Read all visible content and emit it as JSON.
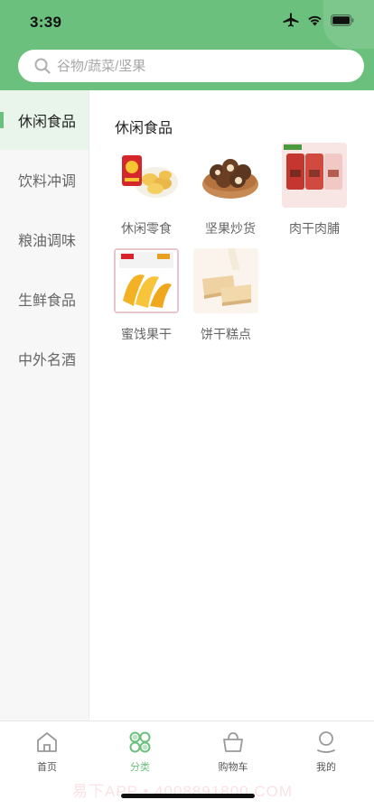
{
  "status_bar": {
    "time": "3:39",
    "icons": [
      "airplane-icon",
      "wifi-icon",
      "battery-icon"
    ]
  },
  "search": {
    "placeholder": "谷物/蔬菜/坚果"
  },
  "sidebar": {
    "items": [
      {
        "label": "休闲食品",
        "active": true
      },
      {
        "label": "饮料冲调",
        "active": false
      },
      {
        "label": "粮油调味",
        "active": false
      },
      {
        "label": "生鲜食品",
        "active": false
      },
      {
        "label": "中外名酒",
        "active": false
      }
    ]
  },
  "content": {
    "section_title": "休闲食品",
    "categories": [
      {
        "label": "休闲零食",
        "image": "chips-image"
      },
      {
        "label": "坚果炒货",
        "image": "macadamia-image"
      },
      {
        "label": "肉干肉脯",
        "image": "jerky-image"
      },
      {
        "label": "蜜饯果干",
        "image": "dried-mango-image"
      },
      {
        "label": "饼干糕点",
        "image": "wafer-image"
      }
    ]
  },
  "tabbar": {
    "items": [
      {
        "label": "首页",
        "icon": "home-icon",
        "active": false
      },
      {
        "label": "分类",
        "icon": "category-icon",
        "active": true
      },
      {
        "label": "购物车",
        "icon": "basket-icon",
        "active": false
      },
      {
        "label": "我的",
        "icon": "user-icon",
        "active": false
      }
    ]
  },
  "watermark": "易下APP • 4008891800.COM",
  "colors": {
    "brand_green": "#6bc07d",
    "sidebar_bg": "#f7f7f7",
    "active_item_bg": "#e9f5ea"
  }
}
